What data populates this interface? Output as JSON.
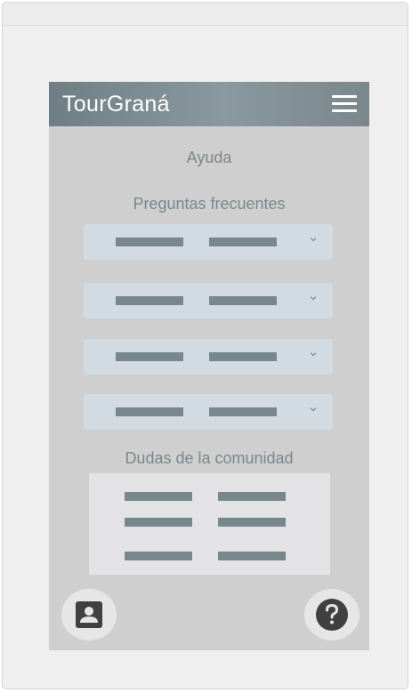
{
  "app": {
    "title": "TourGraná"
  },
  "page": {
    "heading": "Ayuda",
    "faq_heading": "Preguntas frecuentes",
    "community_heading": "Dudas de la comunidad"
  },
  "faq_items": [
    {
      "icon": "chevron-down-icon"
    },
    {
      "icon": "chevron-down-icon"
    },
    {
      "icon": "chevron-down-icon"
    },
    {
      "icon": "chevron-down-icon"
    }
  ],
  "bottom_buttons": {
    "left_icon": "account-box-icon",
    "right_icon": "help-circle-icon"
  },
  "colors": {
    "header": "#7f8e94",
    "screen_bg": "#cfcfcf",
    "accent_text": "#7a878d",
    "faq_bg": "#d2dbe2",
    "placeholder_bar": "#77878c",
    "icon_dark": "#404040"
  }
}
